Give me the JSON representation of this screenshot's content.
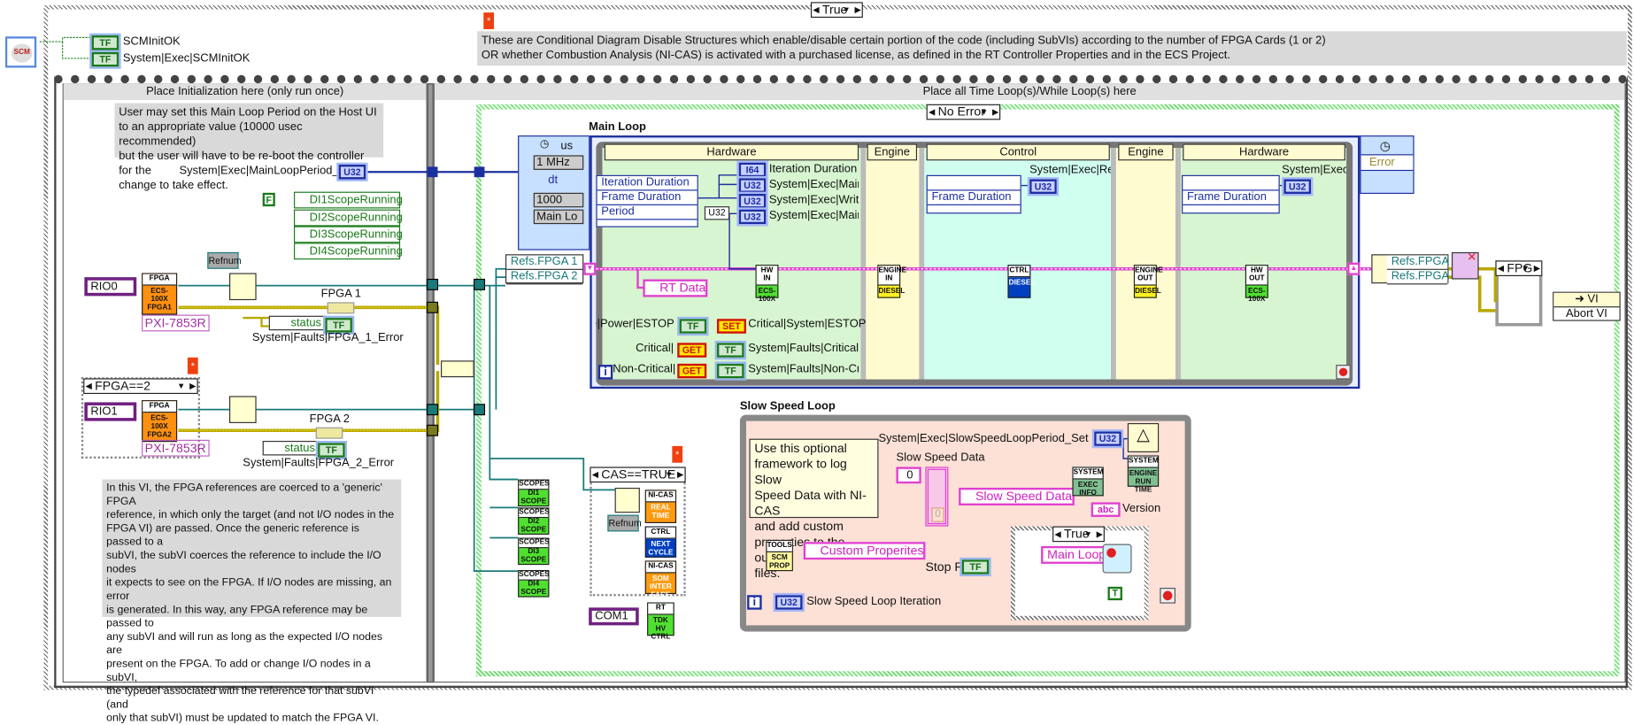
{
  "colors": {
    "wire_data": "#1c2fa0",
    "wire_refnum": "#1a7a7a",
    "wire_error": "#e0d020",
    "wire_cluster": "#e040d0",
    "timed_loop_hardware": "#d7f5d0",
    "timed_loop_engine": "#fffbd0",
    "timed_loop_control": "#d0fff0",
    "slow_loop_bg": "#fde0d6"
  },
  "top": {
    "scm_icon": "SCM",
    "scm_init_ok": "SCMInitOK",
    "system_exec_scm_init_ok": "System|Exec|SCMInitOK",
    "tf": "TF",
    "disable_selector": "True",
    "comment": "These are Conditional Diagram Disable Structures which enable/disable certain portion of the code (including SubVIs) according to the number of FPGA Cards (1 or 2)\nOR whether Combustion Analysis (NI-CAS) is activated with a purchased license, as defined in the RT Controller Properties and in the ECS Project."
  },
  "init_frame": {
    "header": "Place Initialization here (only run once)",
    "comment": "User may set this Main Loop Period on the Host UI\nto an appropriate value (10000 usec recommended)\nbut the user will have to be re-boot the controller for the\nchange to take effect.",
    "main_loop_period_label": "System|Exec|MainLoopPeriod_Set",
    "u32": "U32",
    "false_const": "F",
    "scopes": [
      "DI1ScopeRunning",
      "DI2ScopeRunning",
      "DI3ScopeRunning",
      "DI4ScopeRunning"
    ],
    "refnum": "Refnum",
    "fpga1": {
      "resource": "RIO0",
      "node_header": "FPGA",
      "node_body": "ECS-\n100X\nFPGA1",
      "target": "PXI-7853R",
      "label": "FPGA 1",
      "status": "status",
      "fault": "System|Faults|FPGA_1_Error"
    },
    "fpga2_selector": "FPGA==2",
    "fpga2": {
      "resource": "RIO1",
      "node_header": "FPGA",
      "node_body": "ECS-\n100X\nFPGA2",
      "target": "PXI-7853R",
      "label": "FPGA 2",
      "status": "status",
      "fault": "System|Faults|FPGA_2_Error"
    },
    "comment2": "In this VI, the FPGA references are coerced to a 'generic' FPGA\nreference, in which only the target (and not I/O nodes in the\nFPGA VI) are passed.  Once the generic reference is passed to a\nsubVI, the subVI coerces the reference to include the I/O nodes\nit expects to see on the FPGA.  If I/O nodes are missing, an error\nis generated.  In this way, any FPGA reference may be passed to\nany subVI and will run as long as the expected I/O nodes are\npresent on the FPGA.  To add or change I/O nodes in a subVI,\nthe typedef associated with the reference for that subVI (and\nonly that subVI) must be updated to match the FPGA VI."
  },
  "loops_frame": {
    "header": "Place all Time Loop(s)/While Loop(s) here",
    "error_selector": "No Error",
    "refs": [
      "Refs.FPGA 1",
      "Refs.FPGA 2"
    ],
    "main_loop": {
      "title": "Main Loop",
      "input_node": {
        "unit": "us",
        "source": "1 MHz",
        "dt": "dt",
        "period": "1000",
        "name": "Main Lo"
      },
      "output_node": {
        "error": "Error"
      },
      "frames": [
        {
          "header": "Hardware"
        },
        {
          "header": "Engine"
        },
        {
          "header": "Control"
        },
        {
          "header": "Engine"
        },
        {
          "header": "Hardware"
        }
      ],
      "hw_node_items": [
        "Iteration Duration",
        "Frame Duration",
        "Period"
      ],
      "u32_const": "U32",
      "i64": "I64",
      "hw_indicators": [
        "Iteration Duration",
        "System|Exec|MainL",
        "System|Exec|Write_",
        "System|Exec|MainL"
      ],
      "ctrl_node_item": "Frame Duration",
      "ctrl_indicator": "System|Exec|Read",
      "hw2_node_item": "Frame Duration",
      "hw2_indicator": "System|Exec|Co",
      "subvis": [
        {
          "header": "HW IN",
          "body": "ECS-\n100X"
        },
        {
          "header": "ENGINE\nIN",
          "body": "DIESEL"
        },
        {
          "header": "CTRL",
          "body": "DIESEL"
        },
        {
          "header": "ENGINE\nOUT",
          "body": "DIESEL"
        },
        {
          "header": "HW OUT",
          "body": "ECS-\n100X"
        }
      ],
      "rt_data": "RT Data",
      "faults": [
        {
          "left": "are|Power|ESTOP",
          "a": "TF",
          "b": "SET",
          "right": "Critical|System|ESTOP"
        },
        {
          "left": "Critical|",
          "a": "GET",
          "b": "TF",
          "right": "System|Faults|Critical Fa"
        },
        {
          "left": "Non-Critical|",
          "a": "GET",
          "b": "TF",
          "right": "System|Faults|Non-Critic"
        }
      ],
      "iteration": "i"
    },
    "close_fpga": {
      "refs": [
        "Refs.FPGA 1",
        "Refs.FPGA 2"
      ],
      "selector": "FPG",
      "abort_top": "VI",
      "abort": "Abort VI"
    },
    "scope_vis": [
      {
        "header": "SCOPES",
        "body": "DI1\nSCOPE"
      },
      {
        "header": "SCOPES",
        "body": "DI2\nSCOPE"
      },
      {
        "header": "SCOPES",
        "body": "DI3\nSCOPE"
      },
      {
        "header": "SCOPES",
        "body": "DI4\nSCOPE"
      }
    ],
    "cas": {
      "selector": "CAS==TRUE",
      "refnum": "Refnum",
      "subvis": [
        {
          "header": "NI-CAS",
          "body": "REAL\nTIME"
        },
        {
          "header": "CTRL",
          "body": "NEXT\nCYCLE"
        },
        {
          "header": "NI-CAS",
          "body": "SOM\nINTER\nFACE"
        }
      ]
    },
    "com": {
      "port": "COM1",
      "subvi_header": "RT",
      "subvi_body": "TDK\nHV\nCTRL"
    },
    "slow_loop": {
      "title": "Slow Speed Loop",
      "comment": "Use this optional\nframework to log Slow\nSpeed Data  with NI-CAS\nand add custom\nproperties to the output\nfiles.",
      "period_label": "System|Exec|SlowSpeedLoopPeriod_Set",
      "u32": "U32",
      "run_time": {
        "header": "SYSTEM",
        "body": "ENGINE\nRUN\nTIME"
      },
      "data_label": "Slow Speed Data",
      "index": "0",
      "element": "0",
      "data_var": "Slow Speed Data",
      "exec_info": {
        "header": "SYSTEM",
        "body": "EXEC\nINFO"
      },
      "abc": "abc",
      "version": "Version",
      "tools": {
        "header": "TOOLS",
        "body": "SCM\nPROP"
      },
      "custom": "Custom Properites",
      "stop_rt": "Stop RT",
      "tf": "TF",
      "case_selector": "True",
      "main_loop_const": "Main Loop",
      "true_const": "T",
      "iteration": "i",
      "iteration_label": "Slow Speed Loop Iteration"
    }
  }
}
